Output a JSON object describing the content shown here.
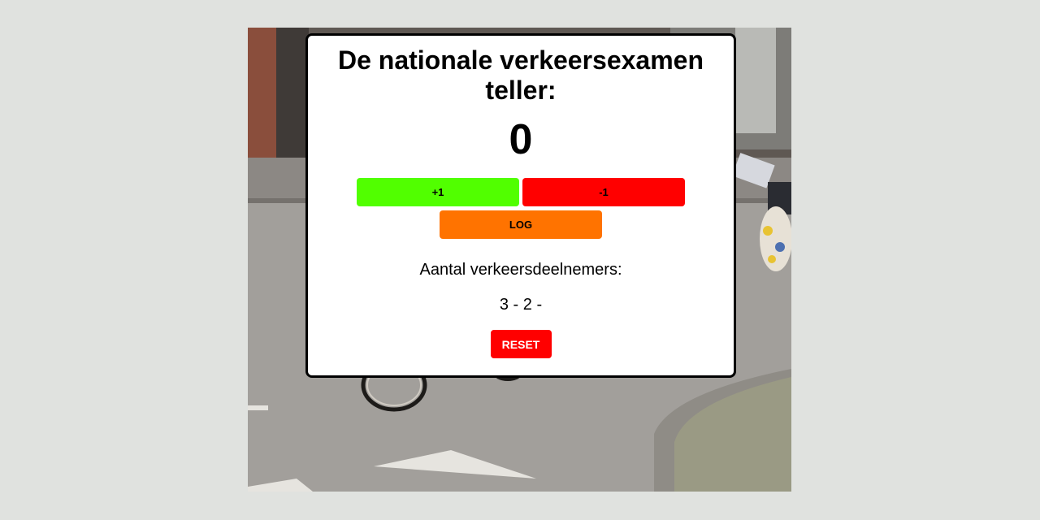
{
  "card": {
    "title": "De nationale verkeersexamen teller:",
    "counter": "0",
    "plus_label": "+1",
    "minus_label": "-1",
    "log_label": "LOG",
    "participants_label": "Aantal verkeersdeelnemers:",
    "log_values": "3 - 2 -",
    "reset_label": "RESET"
  },
  "colors": {
    "plus": "#51ff00",
    "minus": "#ff0000",
    "log": "#ff7300",
    "reset": "#ff0000",
    "page_background": "#e0e2df"
  },
  "background_image": {
    "content": "street-photo-cyclist-road"
  }
}
